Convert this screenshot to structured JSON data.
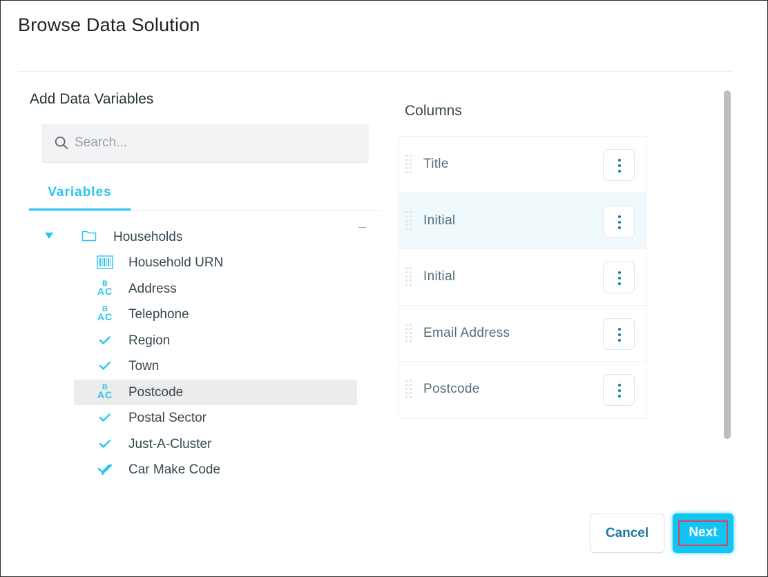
{
  "dialog": {
    "title": "Browse Data Solution"
  },
  "left_panel": {
    "heading": "Add Data Variables",
    "search": {
      "placeholder": "Search...",
      "value": ""
    },
    "tabs": [
      {
        "label": "Variables",
        "active": true
      }
    ],
    "tree": {
      "folder": {
        "label": "Households",
        "expanded": true
      },
      "items": [
        {
          "label": "Household URN",
          "icon": "barcode-icon",
          "selected": false
        },
        {
          "label": "Address",
          "icon": "abc-text-icon",
          "selected": false
        },
        {
          "label": "Telephone",
          "icon": "abc-text-icon",
          "selected": false
        },
        {
          "label": "Region",
          "icon": "check-icon",
          "selected": false
        },
        {
          "label": "Town",
          "icon": "check-icon",
          "selected": false
        },
        {
          "label": "Postcode",
          "icon": "abc-text-icon",
          "selected": true
        },
        {
          "label": "Postal Sector",
          "icon": "check-icon",
          "selected": false
        },
        {
          "label": "Just-A-Cluster",
          "icon": "check-icon",
          "selected": false
        },
        {
          "label": "Car Make Code",
          "icon": "double-check-icon",
          "selected": false
        }
      ]
    }
  },
  "right_panel": {
    "heading": "Columns",
    "columns": [
      {
        "label": "Title",
        "highlighted": false
      },
      {
        "label": "Initial",
        "highlighted": true
      },
      {
        "label": "Initial",
        "highlighted": false
      },
      {
        "label": "Email Address",
        "highlighted": false
      },
      {
        "label": "Postcode",
        "highlighted": false
      }
    ]
  },
  "footer": {
    "cancel_label": "Cancel",
    "next_label": "Next"
  },
  "colors": {
    "accent": "#29c5f0",
    "primary_button": "#12c4f2",
    "button_text": "#1a7aa0",
    "focus_outline": "#d8455a",
    "selected_row": "#ececec",
    "highlight_row": "#f0fafd"
  }
}
